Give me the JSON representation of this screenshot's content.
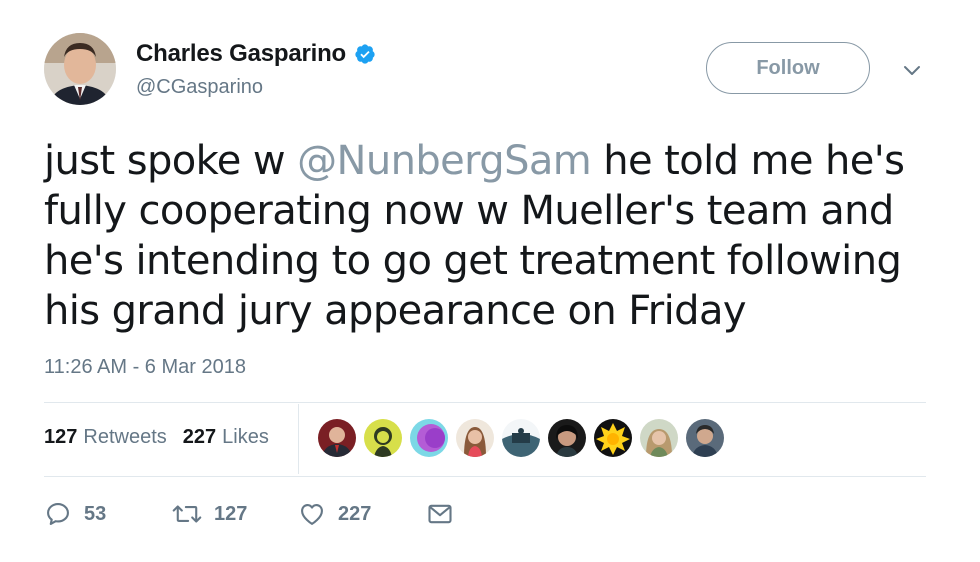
{
  "tweet": {
    "author": {
      "display_name": "Charles Gasparino",
      "handle": "@CGasparino",
      "verified": true
    },
    "follow_label": "Follow",
    "text_segments": {
      "before": "just spoke w ",
      "mention": "@NunbergSam",
      "after": " he told me he's fully cooperating now w Mueller's team and he's intending to go get treatment following his grand jury appearance on Friday"
    },
    "timestamp": "11:26 AM - 6 Mar 2018",
    "stats": {
      "retweets_count": "127",
      "retweets_label": "Retweets",
      "likes_count": "227",
      "likes_label": "Likes"
    },
    "actions": {
      "reply_count": "53",
      "retweet_count": "127",
      "like_count": "227"
    }
  },
  "icons": {
    "verified": "verified-badge-icon",
    "caret": "chevron-down-icon",
    "reply": "reply-icon",
    "retweet": "retweet-icon",
    "like": "heart-icon",
    "dm": "envelope-icon"
  },
  "colors": {
    "text": "#14171a",
    "muted": "#657786",
    "verified_blue": "#1da1f2",
    "border": "#e1e8ed"
  }
}
